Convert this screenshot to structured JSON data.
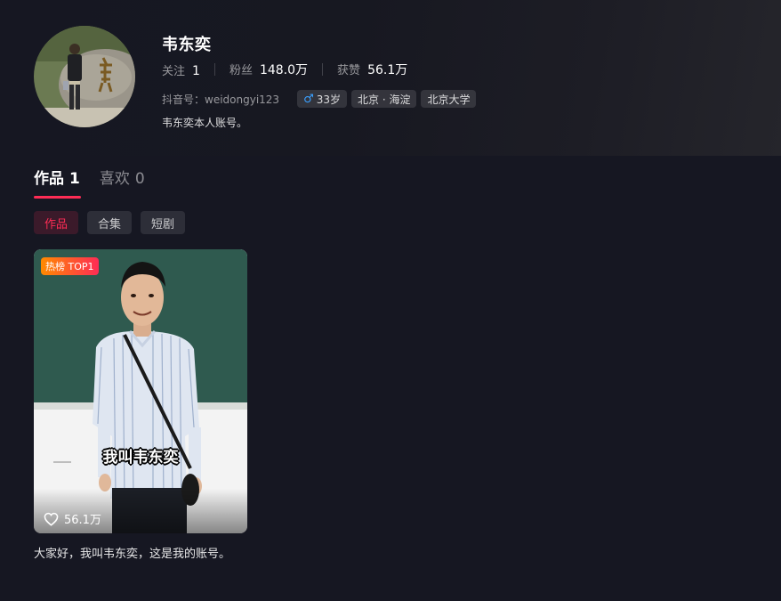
{
  "profile": {
    "username": "韦东奕",
    "stats": [
      {
        "label": "关注",
        "value": "1"
      },
      {
        "label": "粉丝",
        "value": "148.0万"
      },
      {
        "label": "获赞",
        "value": "56.1万"
      }
    ],
    "douyin_id": "抖音号：weidongyi123",
    "tags": {
      "age": "33岁",
      "location": "北京 · 海淀",
      "school": "北京大学"
    },
    "bio": "韦东奕本人账号。"
  },
  "tabs": [
    {
      "label": "作品",
      "count": "1"
    },
    {
      "label": "喜欢",
      "count": "0"
    }
  ],
  "filters": [
    "作品",
    "合集",
    "短剧"
  ],
  "video": {
    "badge": "热榜 TOP1",
    "subtitle": "我叫韦东奕",
    "likes": "56.1万",
    "title": "大家好，我叫韦东奕，这是我的账号。"
  },
  "colors": {
    "background": "#161722",
    "accent": "#fe2c55",
    "male": "#3aa0ff"
  }
}
